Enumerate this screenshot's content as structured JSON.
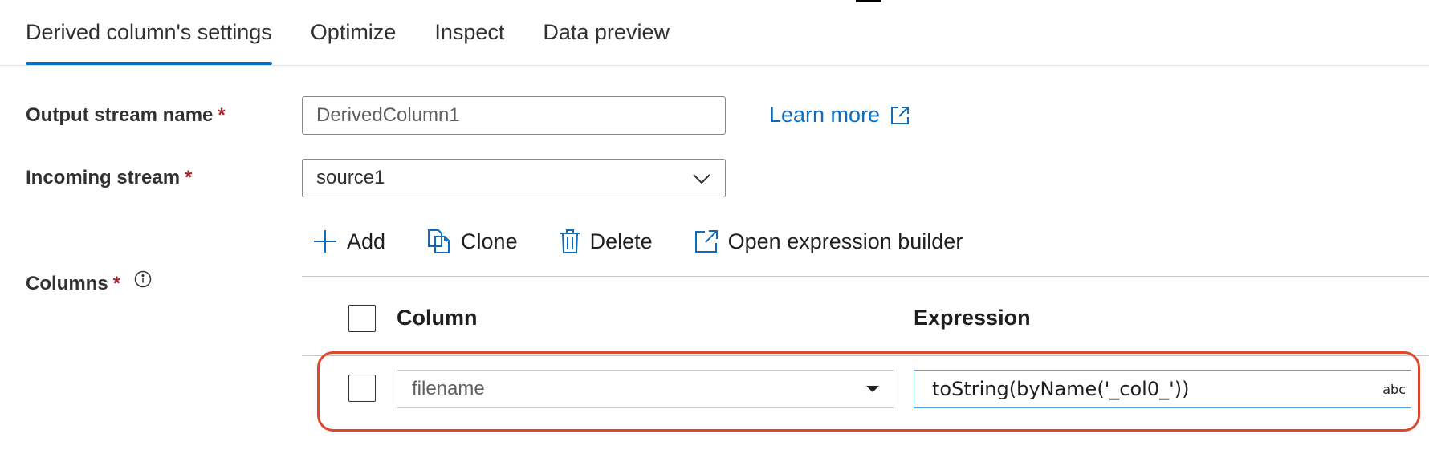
{
  "tabs": [
    {
      "label": "Derived column's settings",
      "active": true
    },
    {
      "label": "Optimize",
      "active": false
    },
    {
      "label": "Inspect",
      "active": false
    },
    {
      "label": "Data preview",
      "active": false
    }
  ],
  "form": {
    "output_stream": {
      "label": "Output stream name",
      "required_mark": "*",
      "value": "DerivedColumn1"
    },
    "incoming_stream": {
      "label": "Incoming stream",
      "required_mark": "*",
      "value": "source1"
    },
    "columns": {
      "label": "Columns",
      "required_mark": "*"
    }
  },
  "learn_more": {
    "label": "Learn more"
  },
  "toolbar": {
    "add_label": "Add",
    "clone_label": "Clone",
    "delete_label": "Delete",
    "open_builder_label": "Open expression builder"
  },
  "grid": {
    "headers": {
      "column": "Column",
      "expression": "Expression"
    },
    "rows": [
      {
        "column": "filename",
        "expression": "toString(byName('_col0_'))",
        "type_badge": "abc"
      }
    ]
  },
  "colors": {
    "accent": "#0f6cbd",
    "required": "#a4262c",
    "highlight": "#e0462c",
    "focus_border": "#5aa3e2"
  }
}
